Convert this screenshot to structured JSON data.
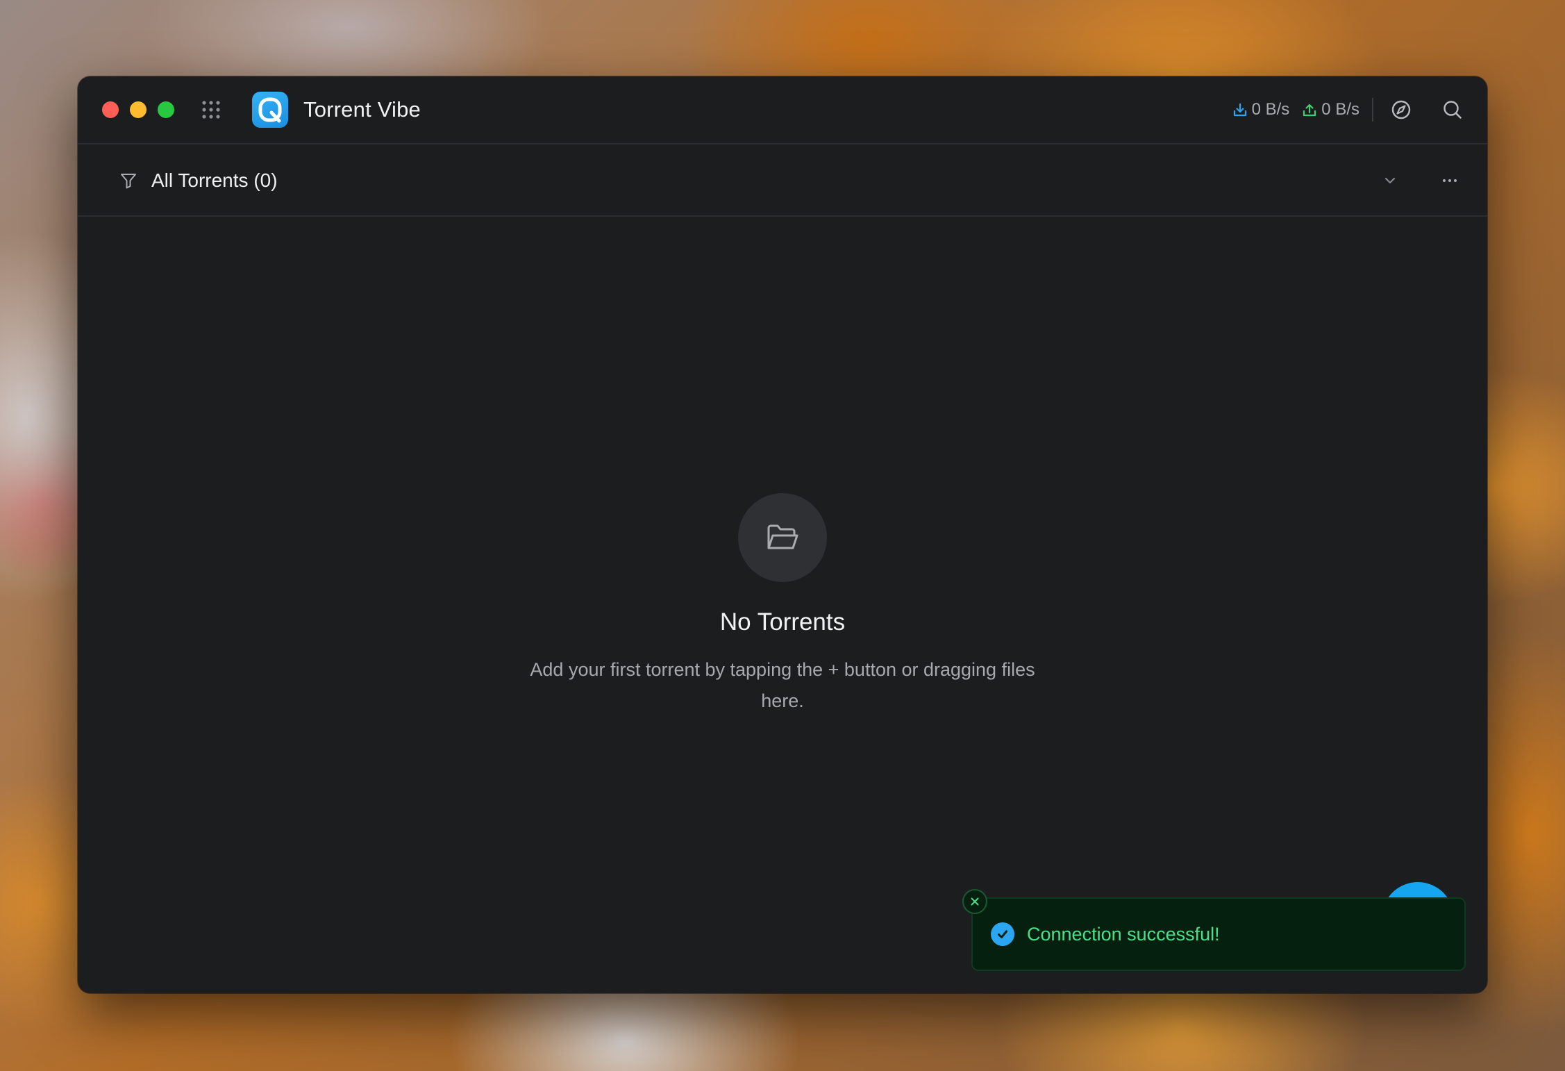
{
  "window": {
    "title": "Torrent Vibe",
    "app_icon_letter": "Q"
  },
  "titlebar": {
    "download_speed": "0 B/s",
    "upload_speed": "0 B/s",
    "icons": [
      "grid-icon",
      "download-icon",
      "upload-icon",
      "compass-icon",
      "search-icon"
    ]
  },
  "filter": {
    "label": "All Torrents (0)",
    "icons": [
      "filter-icon",
      "chevron-down-icon",
      "more-icon"
    ]
  },
  "empty_state": {
    "icon": "folder-open-icon",
    "title": "No Torrents",
    "description": "Add your first torrent by tapping the + button or dragging files here."
  },
  "toast": {
    "message": "Connection successful!",
    "icons": [
      "check-circle-icon",
      "close-icon"
    ]
  },
  "colors": {
    "accent": "#16a6f0",
    "download": "#2aa6f2",
    "upload": "#3ecf74",
    "success_text": "#48e08a"
  }
}
